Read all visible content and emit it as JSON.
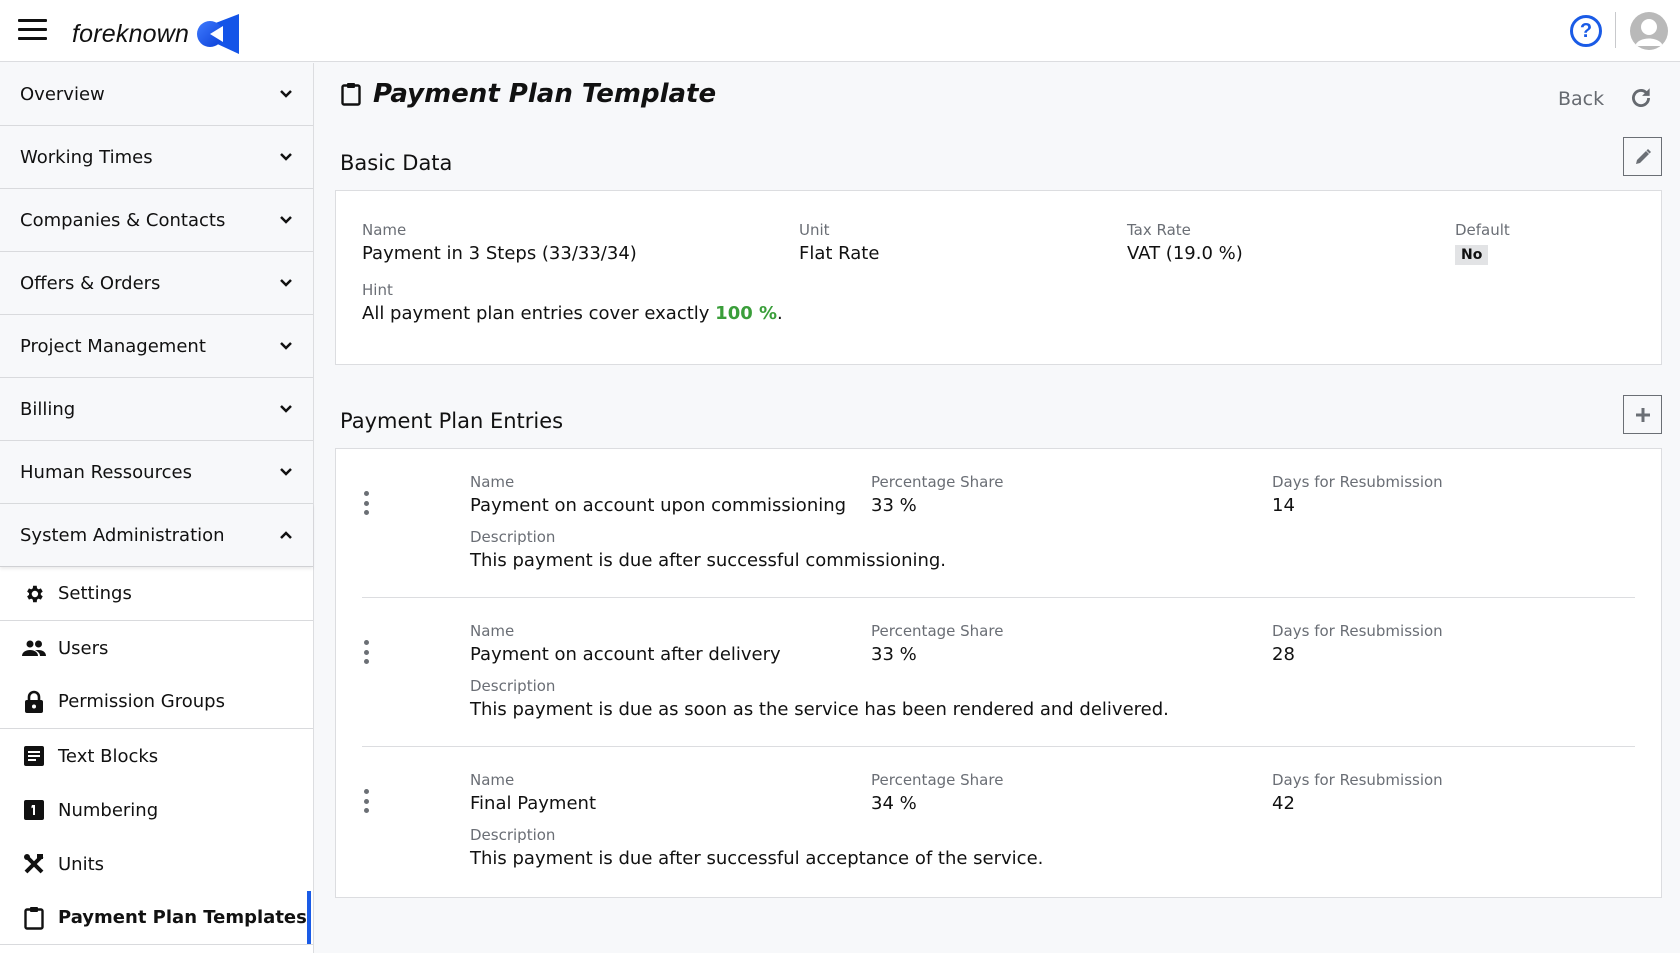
{
  "header": {
    "logo_text": "foreknown",
    "help_label": "?"
  },
  "sidebar": {
    "groups": [
      {
        "label": "Overview",
        "expanded": false
      },
      {
        "label": "Working Times",
        "expanded": false
      },
      {
        "label": "Companies & Contacts",
        "expanded": false
      },
      {
        "label": "Offers & Orders",
        "expanded": false
      },
      {
        "label": "Project Management",
        "expanded": false
      },
      {
        "label": "Billing",
        "expanded": false
      },
      {
        "label": "Human Ressources",
        "expanded": false
      },
      {
        "label": "System Administration",
        "expanded": true
      }
    ],
    "sub_items": [
      {
        "label": "Settings",
        "icon": "gear-icon"
      },
      {
        "label": "Users",
        "icon": "users-icon"
      },
      {
        "label": "Permission Groups",
        "icon": "lock-icon"
      },
      {
        "label": "Text Blocks",
        "icon": "text-block-icon"
      },
      {
        "label": "Numbering",
        "icon": "numbering-icon"
      },
      {
        "label": "Units",
        "icon": "tools-icon"
      },
      {
        "label": "Payment Plan Templates",
        "icon": "clipboard-icon",
        "active": true
      }
    ]
  },
  "page": {
    "title": "Payment Plan Template",
    "back_label": "Back"
  },
  "basic_data": {
    "title": "Basic Data",
    "name_label": "Name",
    "name_value": "Payment in 3 Steps (33/33/34)",
    "unit_label": "Unit",
    "unit_value": "Flat Rate",
    "tax_label": "Tax Rate",
    "tax_value": "VAT (19.0 %)",
    "default_label": "Default",
    "default_value": "No",
    "hint_label": "Hint",
    "hint_prefix": "All payment plan entries cover exactly ",
    "hint_percent": "100 %",
    "hint_suffix": "."
  },
  "entries": {
    "title": "Payment Plan Entries",
    "labels": {
      "name": "Name",
      "percentage": "Percentage Share",
      "days": "Days for Resubmission",
      "description": "Description"
    },
    "items": [
      {
        "name": "Payment on account upon commissioning",
        "percentage": "33 %",
        "days": "14",
        "description": "This payment is due after successful commissioning."
      },
      {
        "name": "Payment on account after delivery",
        "percentage": "33 %",
        "days": "28",
        "description": "This payment is due as soon as the service has been rendered and delivered."
      },
      {
        "name": "Final Payment",
        "percentage": "34 %",
        "days": "42",
        "description": "This payment is due after successful acceptance of the service."
      }
    ]
  },
  "colors": {
    "accent": "#1a5be6",
    "success": "#3a9e3a"
  }
}
